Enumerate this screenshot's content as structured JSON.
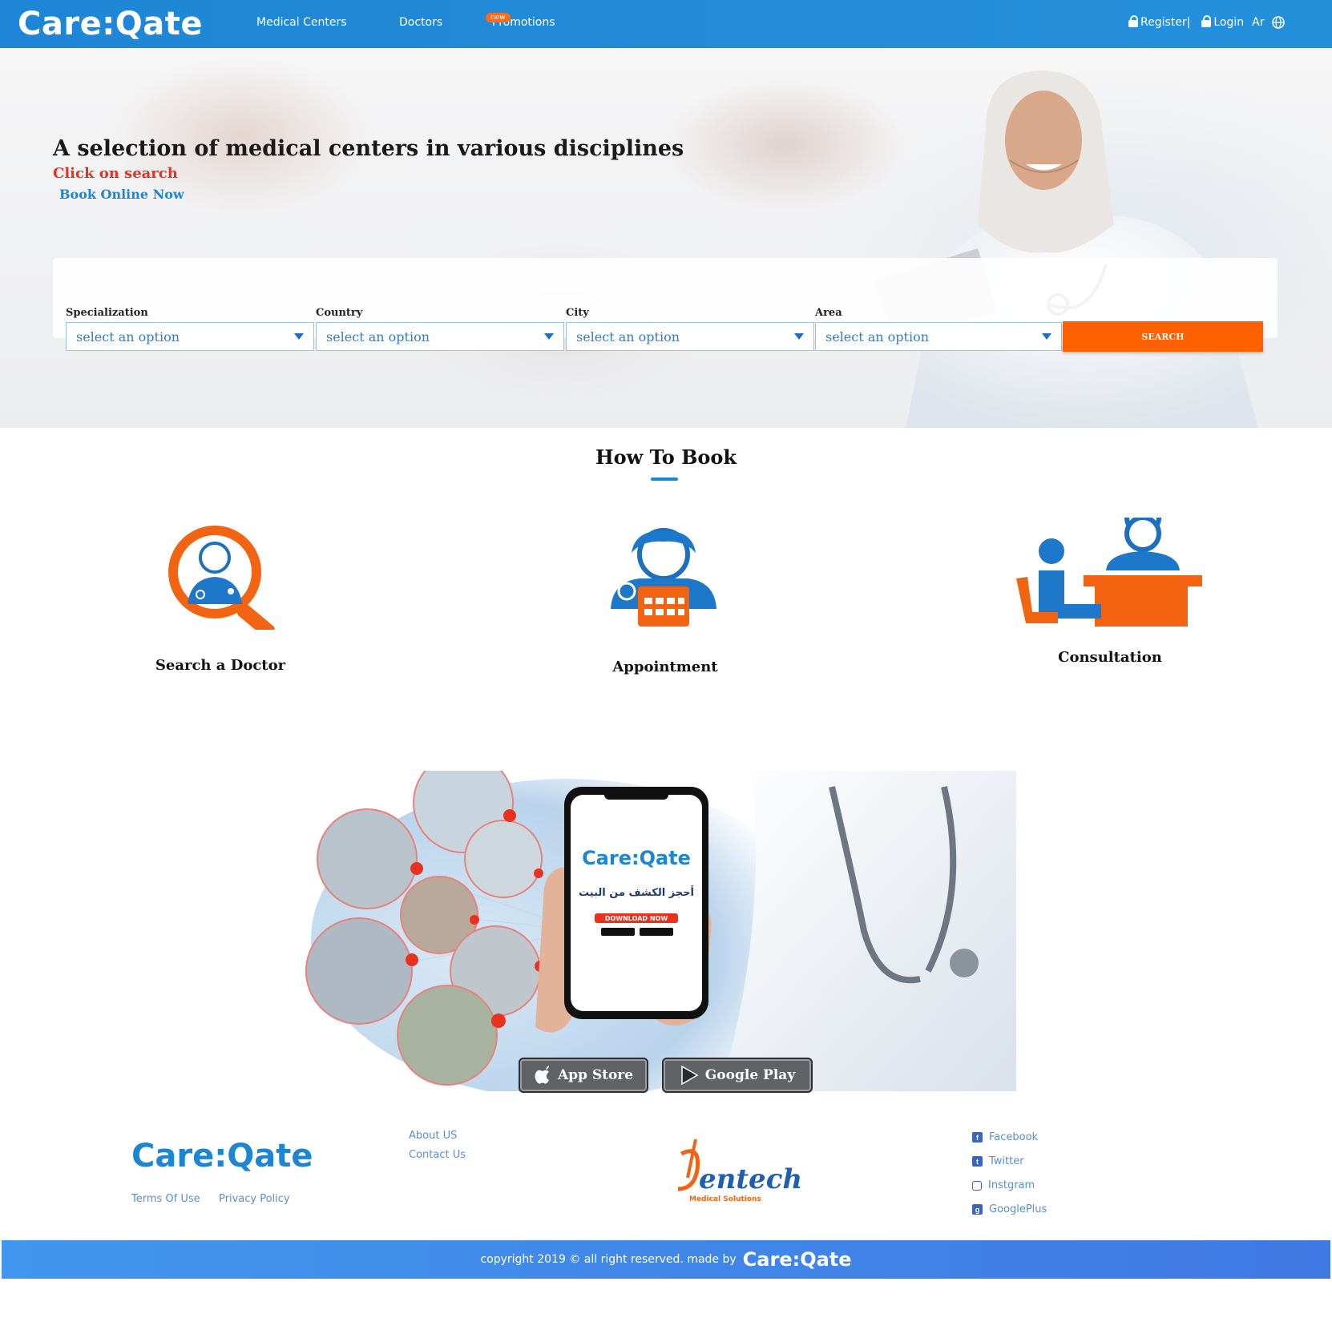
{
  "header": {
    "logo": "Care:Qate",
    "nav": [
      "Medical Centers",
      "Doctors",
      "Promotions"
    ],
    "new_badge": "new",
    "register": "Register|",
    "login": "Login",
    "lang": "Ar"
  },
  "hero": {
    "title": "A selection of medical centers in various disciplines",
    "subtitle_red": "Click on search",
    "subtitle_blue": "Book Online Now"
  },
  "search": {
    "fields": [
      {
        "label": "Specialization",
        "value": "select an option"
      },
      {
        "label": "Country",
        "value": "select an option"
      },
      {
        "label": "City",
        "value": "select an option"
      },
      {
        "label": "Area",
        "value": "select an option"
      }
    ],
    "button": "SEARCH"
  },
  "how_to_book": {
    "title": "How To Book",
    "steps": [
      "Search a Doctor",
      "Appointment",
      "Consultation"
    ]
  },
  "promo": {
    "phone_logo": "Care:Qate",
    "phone_arabic": "أحجز الكشف من البيت",
    "phone_download": "DOWNLOAD NOW",
    "app_store": "App Store",
    "google_play": "Google Play"
  },
  "footer": {
    "logo": "Care:Qate",
    "terms": "Terms Of Use",
    "privacy": "Privacy Policy",
    "about": "About US",
    "contact": "Contact Us",
    "partner_name": "entech",
    "partner_sub": "Medical Solutions",
    "social": [
      "Facebook",
      "Twitter",
      "Instgram",
      "GooglePlus"
    ],
    "copyright": "copyright 2019 © all right reserved. made by",
    "copyright_logo": "Care:Qate"
  },
  "colors": {
    "primary": "#1e86d6",
    "accent": "#ff6000",
    "hero_red": "#e8321f"
  }
}
